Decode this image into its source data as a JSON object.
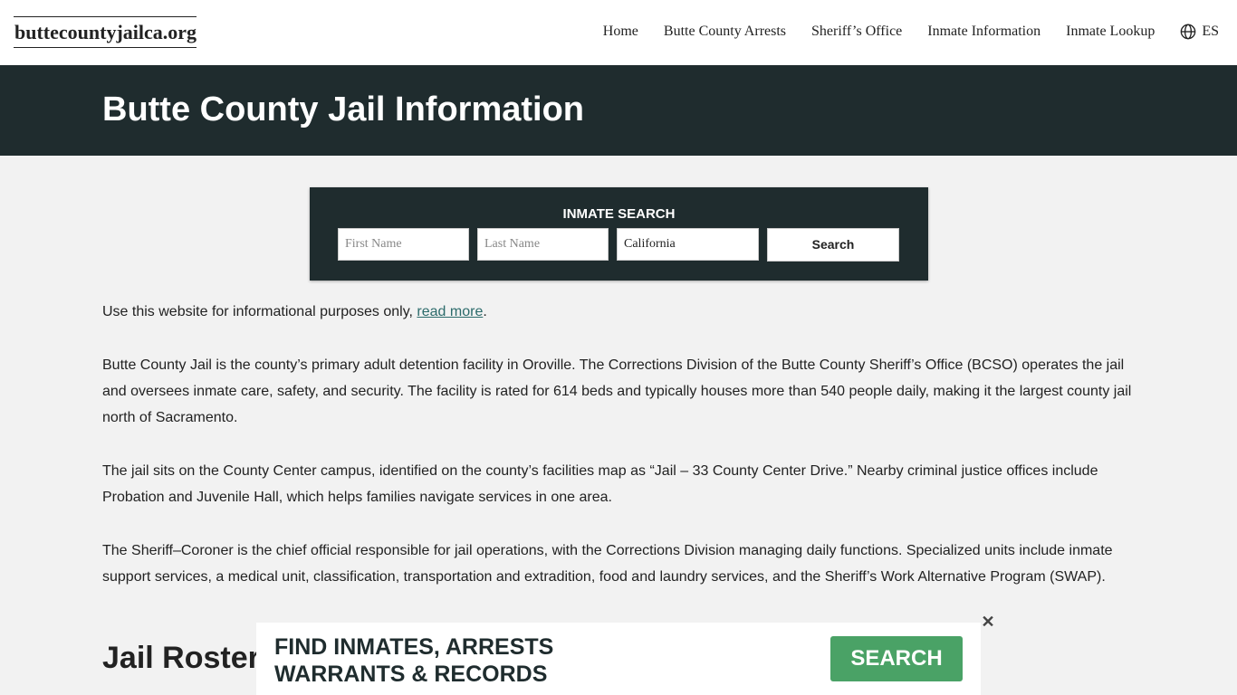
{
  "header": {
    "logo": "buttecountyjailca.org",
    "nav": [
      "Home",
      "Butte County Arrests",
      "Sheriff’s Office",
      "Inmate Information",
      "Inmate Lookup"
    ],
    "lang": "ES"
  },
  "hero": {
    "title": "Butte County Jail Information"
  },
  "search": {
    "title": "INMATE SEARCH",
    "first_placeholder": "First Name",
    "last_placeholder": "Last Name",
    "state": "California",
    "button": "Search"
  },
  "content": {
    "disclaimer_prefix": "Use this website for informational purposes only, ",
    "disclaimer_link": "read more",
    "disclaimer_suffix": ".",
    "p1": "Butte County Jail is the county’s primary adult detention facility in Oroville. The Corrections Division of the Butte County Sheriff’s Office (BCSO) operates the jail and oversees inmate care, safety, and security. The facility is rated for 614 beds and typically houses more than 540 people daily, making it the largest county jail north of Sacramento.",
    "p2": "The jail sits on the County Center campus, identified on the county’s facilities map as “Jail – 33 County Center Drive.” Nearby criminal justice offices include Probation and Juvenile Hall, which helps families navigate services in one area.",
    "p3": "The Sheriff–Coroner is the chief official responsible for jail operations, with the Corrections Division managing daily functions. Specialized units include inmate support services, a medical unit, classification, transportation and extradition, food and laundry services, and the Sheriff’s Work Alternative Program (SWAP).",
    "h2": "Jail Roster"
  },
  "banner": {
    "line1": "FIND INMATES, ARRESTS",
    "line2": "WARRANTS & RECORDS",
    "button": "SEARCH",
    "close": "✕"
  },
  "colors": {
    "dark": "#1f2c2e",
    "accent_green": "#4aa266",
    "link": "#2c6b6b"
  }
}
